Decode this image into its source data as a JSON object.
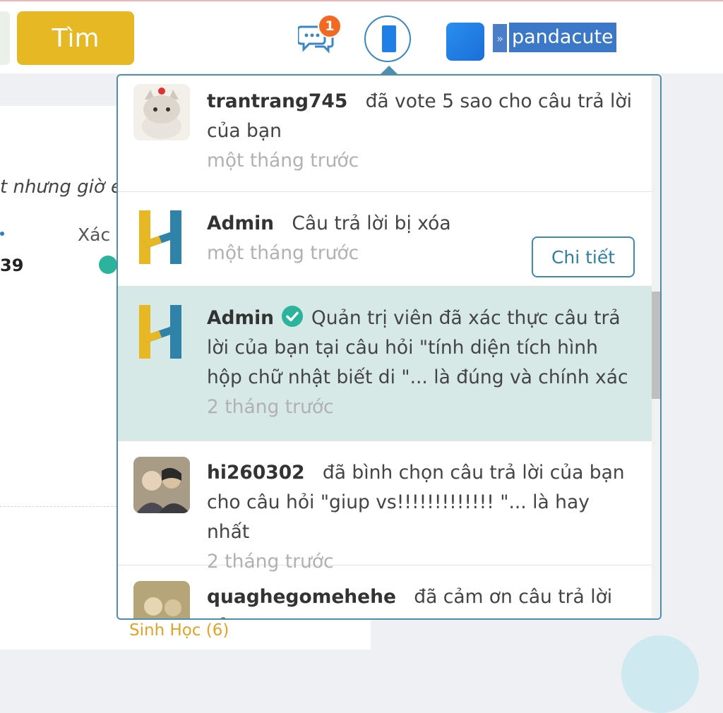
{
  "header": {
    "search_button": "Tìm",
    "message_badge": "1",
    "username": "pandacute"
  },
  "background": {
    "italic_text": "t nhưng giờ e",
    "label_xac": "Xác",
    "number": "39",
    "subject_link": "Sinh Học (6)"
  },
  "notifications": [
    {
      "user": "trantrang745",
      "text": "đã vote 5 sao cho câu trả lời của bạn",
      "time": "một tháng trước",
      "avatar": "cat-avatar"
    },
    {
      "user": "Admin",
      "text": "Câu trả lời bị xóa",
      "time": "một tháng trước",
      "avatar": "hoc24-logo",
      "button": "Chi tiết"
    },
    {
      "user": "Admin",
      "text": "Quản trị viên đã xác thực câu trả lời của bạn tại câu hỏi \"tính diện tích hình hộp chữ nhật biết di \"... là đúng và chính xác",
      "time": "2 tháng trước",
      "avatar": "hoc24-logo",
      "verified": true
    },
    {
      "user": "hi260302",
      "text": "đã bình chọn câu trả lời của bạn cho câu hỏi \"giup vs!!!!!!!!!!!!! \"... là hay nhất",
      "time": "2 tháng trước",
      "avatar": "photo-avatar"
    },
    {
      "user": "quaghegomehehe",
      "text": "đã cảm ơn câu trả lời của",
      "time": "",
      "avatar": "photo-avatar"
    }
  ],
  "colors": {
    "accent": "#e6b824",
    "panel_border": "#4e8fb0",
    "highlight": "#d6e9e6",
    "verified": "#2bb39b",
    "badge": "#f26a21"
  }
}
